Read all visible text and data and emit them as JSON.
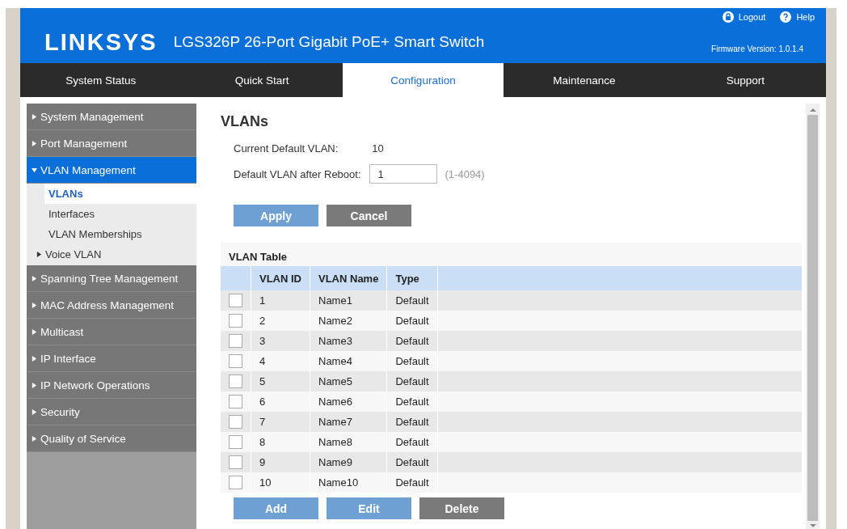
{
  "header": {
    "logo": "LINKSYS",
    "product": "LGS326P 26-Port Gigabit PoE+ Smart Switch",
    "links": [
      {
        "kind": "logout",
        "label": "Logout"
      },
      {
        "kind": "help",
        "label": "Help"
      }
    ],
    "firmware": "Firmware Version: 1.0.1.4"
  },
  "tabs": [
    {
      "label": "System Status",
      "selected": false
    },
    {
      "label": "Quick Start",
      "selected": false
    },
    {
      "label": "Configuration",
      "selected": true
    },
    {
      "label": "Maintenance",
      "selected": false
    },
    {
      "label": "Support",
      "selected": false
    }
  ],
  "sidebar": {
    "items": [
      {
        "label": "System Management",
        "expanded": false
      },
      {
        "label": "Port Management",
        "expanded": false
      },
      {
        "label": "VLAN Management",
        "expanded": true,
        "children": [
          {
            "label": "VLANs",
            "kind": "link",
            "selected": true
          },
          {
            "label": "Interfaces",
            "kind": "link",
            "selected": false
          },
          {
            "label": "VLAN Memberships",
            "kind": "link",
            "selected": false
          },
          {
            "label": "Voice VLAN",
            "kind": "folder",
            "selected": false
          }
        ]
      },
      {
        "label": "Spanning Tree Management",
        "expanded": false
      },
      {
        "label": "MAC Address Management",
        "expanded": false
      },
      {
        "label": "Multicast",
        "expanded": false
      },
      {
        "label": "IP Interface",
        "expanded": false
      },
      {
        "label": "IP Network Operations",
        "expanded": false
      },
      {
        "label": "Security",
        "expanded": false
      },
      {
        "label": "Quality of Service",
        "expanded": false
      }
    ]
  },
  "page": {
    "title": "VLANs",
    "current_default": {
      "label": "Current Default VLAN:",
      "value": "10"
    },
    "after_reboot": {
      "label": "Default VLAN after Reboot:",
      "value": "1",
      "hint": "(1-4094)"
    },
    "form_buttons": [
      {
        "label": "Apply",
        "kind": "primary"
      },
      {
        "label": "Cancel",
        "kind": "secondary"
      }
    ],
    "table": {
      "title": "VLAN Table",
      "columns": [
        "VLAN ID",
        "VLAN Name",
        "Type"
      ],
      "rows": [
        {
          "cells": [
            "1",
            "Name1",
            "Default"
          ],
          "checked": false
        },
        {
          "cells": [
            "2",
            "Name2",
            "Default"
          ],
          "checked": false
        },
        {
          "cells": [
            "3",
            "Name3",
            "Default"
          ],
          "checked": false
        },
        {
          "cells": [
            "4",
            "Name4",
            "Default"
          ],
          "checked": false
        },
        {
          "cells": [
            "5",
            "Name5",
            "Default"
          ],
          "checked": false
        },
        {
          "cells": [
            "6",
            "Name6",
            "Default"
          ],
          "checked": false
        },
        {
          "cells": [
            "7",
            "Name7",
            "Default"
          ],
          "checked": false
        },
        {
          "cells": [
            "8",
            "Name8",
            "Default"
          ],
          "checked": false
        },
        {
          "cells": [
            "9",
            "Name9",
            "Default"
          ],
          "checked": false
        },
        {
          "cells": [
            "10",
            "Name10",
            "Default"
          ],
          "checked": false
        }
      ]
    },
    "table_buttons": [
      {
        "label": "Add",
        "kind": "primary"
      },
      {
        "label": "Edit",
        "kind": "primary"
      },
      {
        "label": "Delete",
        "kind": "secondary"
      }
    ]
  }
}
